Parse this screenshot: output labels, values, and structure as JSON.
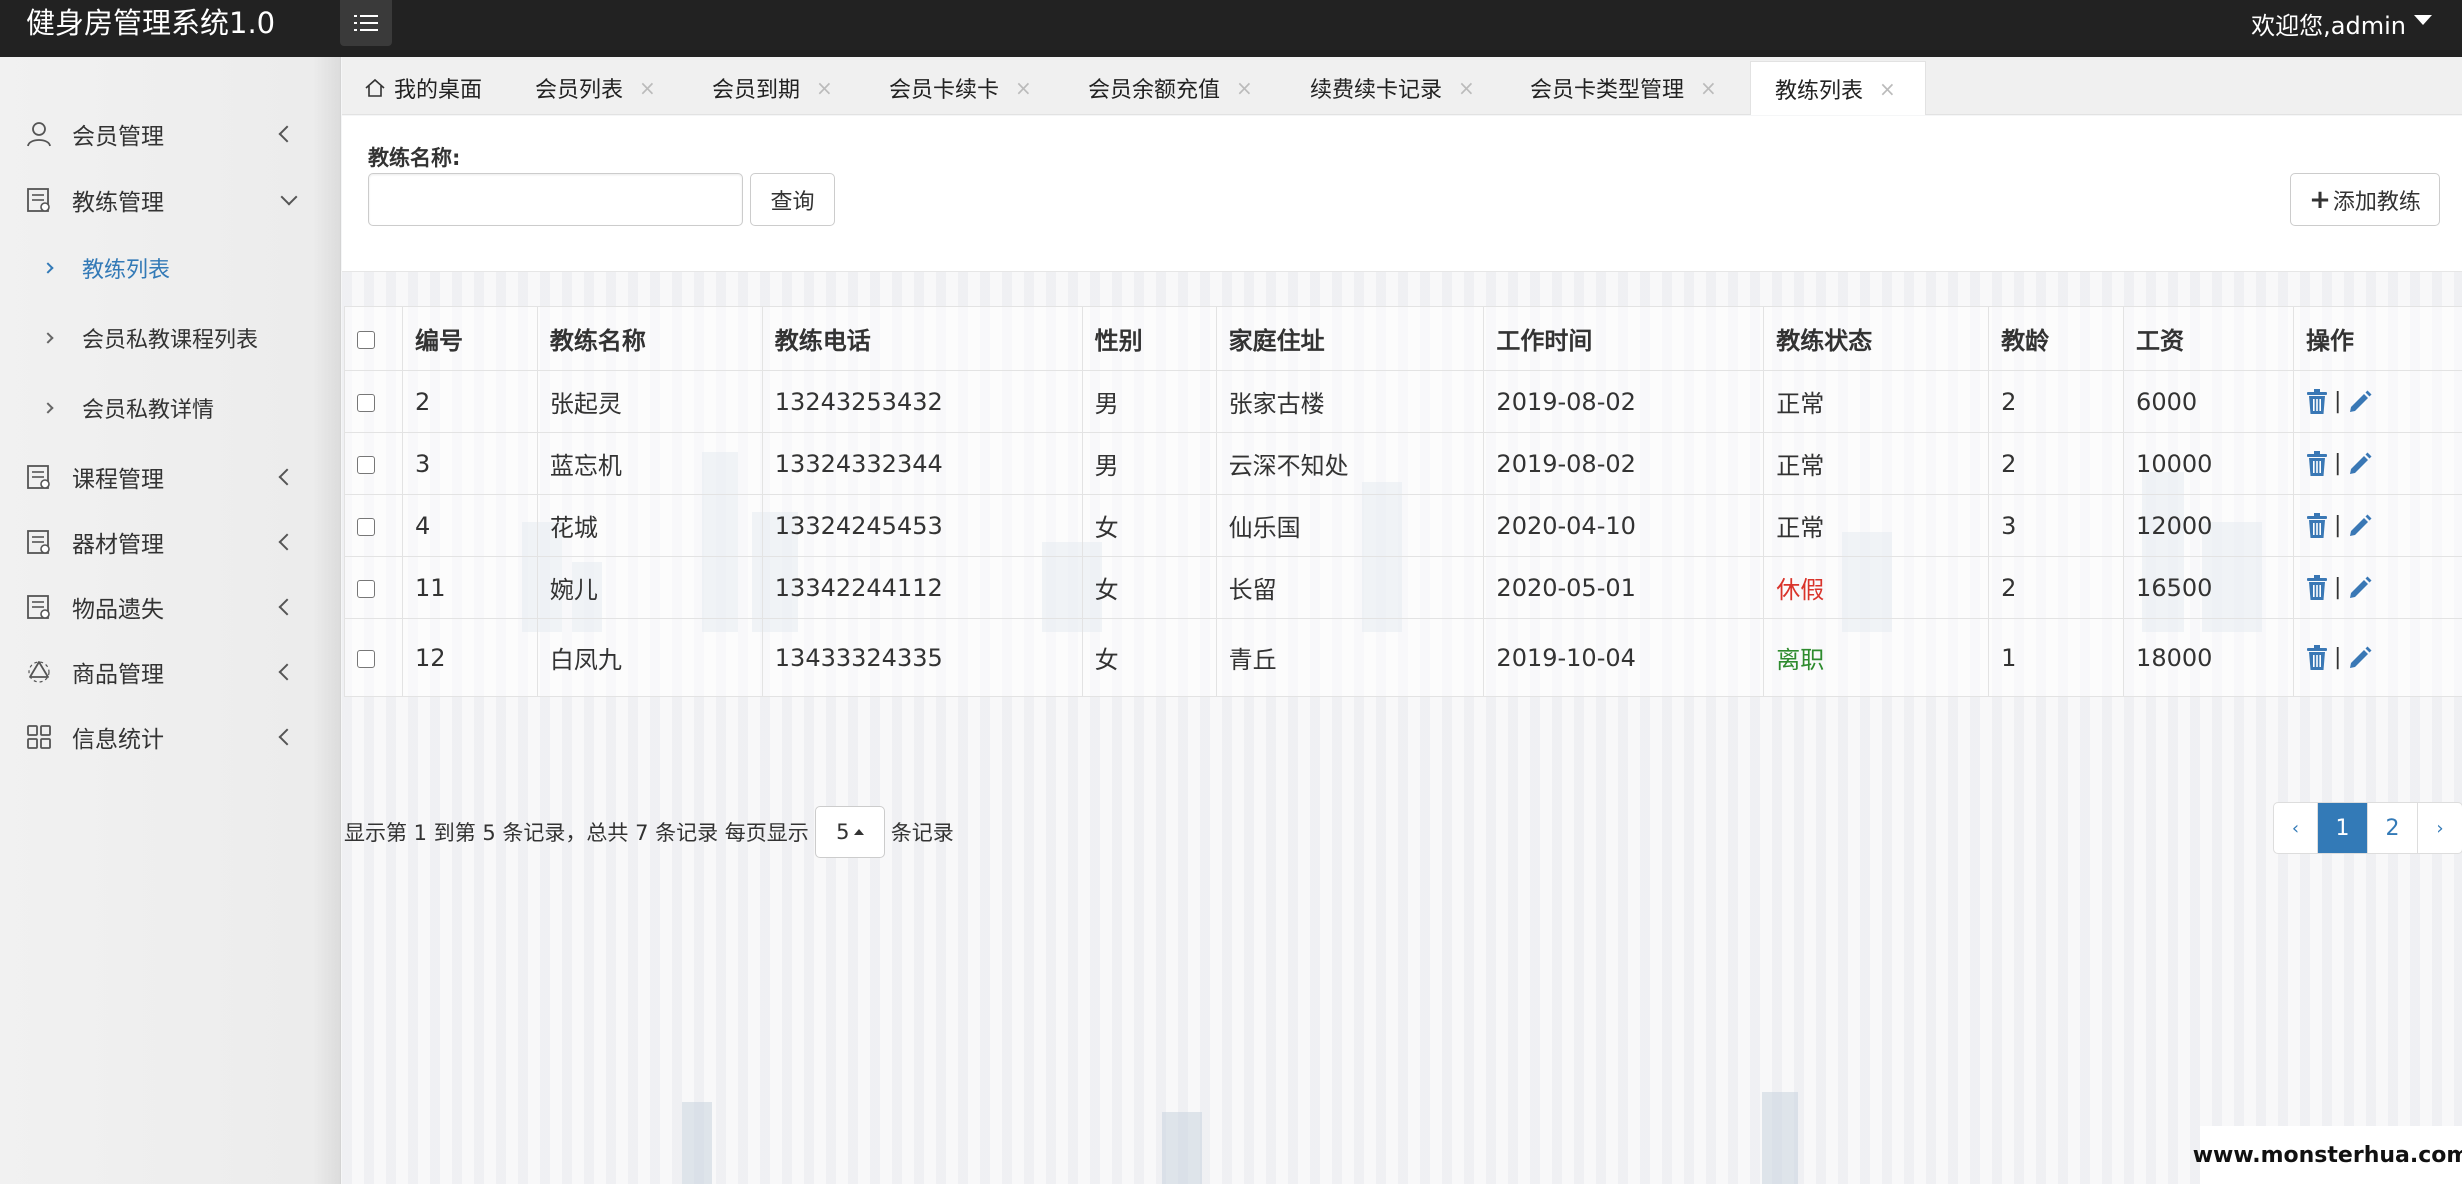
{
  "header": {
    "app_title": "健身房管理系统1.0",
    "user_greeting": "欢迎您,admin"
  },
  "sidebar": {
    "items": [
      {
        "label": "会员管理",
        "icon": "user-icon"
      },
      {
        "label": "教练管理",
        "icon": "document-icon",
        "expanded": true,
        "children": [
          {
            "label": "教练列表",
            "active": true
          },
          {
            "label": "会员私教课程列表"
          },
          {
            "label": "会员私教详情"
          }
        ]
      },
      {
        "label": "课程管理",
        "icon": "document-icon"
      },
      {
        "label": "器材管理",
        "icon": "document-icon"
      },
      {
        "label": "物品遗失",
        "icon": "document-icon"
      },
      {
        "label": "商品管理",
        "icon": "recycle-icon"
      },
      {
        "label": "信息统计",
        "icon": "grid-icon"
      }
    ]
  },
  "tabs": [
    {
      "label": "我的桌面",
      "icon": "home-icon"
    },
    {
      "label": "会员列表"
    },
    {
      "label": "会员到期"
    },
    {
      "label": "会员卡续卡"
    },
    {
      "label": "会员余额充值"
    },
    {
      "label": "续费续卡记录"
    },
    {
      "label": "会员卡类型管理"
    },
    {
      "label": "教练列表",
      "active": true
    }
  ],
  "tab_close_glyph": "×",
  "search": {
    "label": "教练名称:",
    "value": "",
    "placeholder": "",
    "query_button": "查询",
    "add_button": "添加教练"
  },
  "table": {
    "columns": [
      "编号",
      "教练名称",
      "教练电话",
      "性别",
      "家庭住址",
      "工作时间",
      "教练状态",
      "教龄",
      "工资",
      "操作"
    ],
    "rows": [
      {
        "id": "2",
        "name": "张起灵",
        "phone": "13243253432",
        "gender": "男",
        "address": "张家古楼",
        "work_date": "2019-08-02",
        "status": "正常",
        "status_type": "normal",
        "years": "2",
        "salary": "6000"
      },
      {
        "id": "3",
        "name": "蓝忘机",
        "phone": "13324332344",
        "gender": "男",
        "address": "云深不知处",
        "work_date": "2019-08-02",
        "status": "正常",
        "status_type": "normal",
        "years": "2",
        "salary": "10000"
      },
      {
        "id": "4",
        "name": "花城",
        "phone": "13324245453",
        "gender": "女",
        "address": "仙乐国",
        "work_date": "2020-04-10",
        "status": "正常",
        "status_type": "normal",
        "years": "3",
        "salary": "12000"
      },
      {
        "id": "11",
        "name": "婉儿",
        "phone": "13342244112",
        "gender": "女",
        "address": "长留",
        "work_date": "2020-05-01",
        "status": "休假",
        "status_type": "leave",
        "years": "2",
        "salary": "16500"
      },
      {
        "id": "12",
        "name": "白凤九",
        "phone": "13433324335",
        "gender": "女",
        "address": "青丘",
        "work_date": "2019-10-04",
        "status": "离职",
        "status_type": "quit",
        "years": "1",
        "salary": "18000"
      }
    ],
    "op_separator": "|",
    "status_colors": {
      "normal": "#333333",
      "leave": "#d9342b",
      "quit": "#2e8b2e"
    }
  },
  "pagination": {
    "info_prefix": "显示第 1 到第 5 条记录，总共 7 条记录 每页显示",
    "page_size": "5",
    "info_suffix": "条记录",
    "prev": "‹",
    "pages": [
      "1",
      "2"
    ],
    "current": "1",
    "next": "›"
  },
  "watermark": "www.monsterhua.com",
  "colors": {
    "accent": "#337ab7",
    "topbar": "#222222"
  }
}
